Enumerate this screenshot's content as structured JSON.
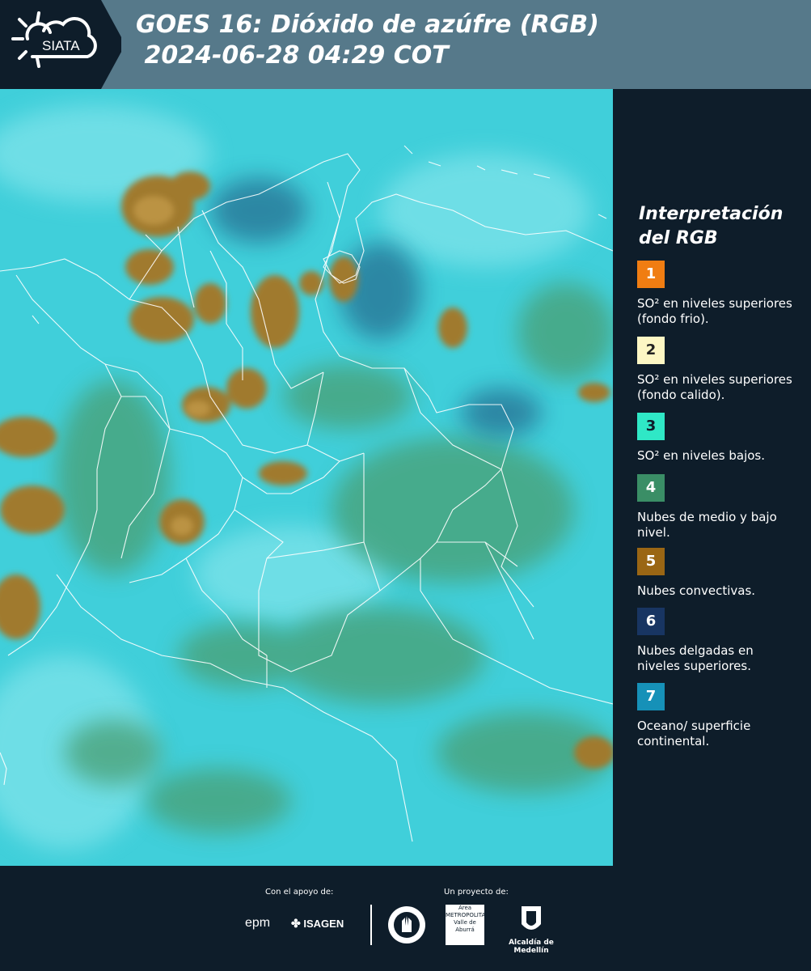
{
  "header": {
    "logo_text": "SIATA",
    "title_line1": "GOES 16: Dióxido de azúfre (RGB)",
    "title_line2": " 2024-06-28 04:29 COT",
    "background": "#56798a"
  },
  "legend": {
    "title": "Interpretación del RGB",
    "items": [
      {
        "number": "1",
        "color": "#f07d12",
        "text": "SO² en niveles superiores (fondo frio)."
      },
      {
        "number": "2",
        "color": "#fdf7c4",
        "text": "SO² en niveles superiores (fondo calido)."
      },
      {
        "number": "3",
        "color": "#2fe8c6",
        "text": "SO² en niveles bajos."
      },
      {
        "number": "4",
        "color": "#3a8e66",
        "text": "Nubes de medio y bajo nivel."
      },
      {
        "number": "5",
        "color": "#9a6614",
        "text": "Nubes convectivas."
      },
      {
        "number": "6",
        "color": "#183562",
        "text": "Nubes delgadas en niveles superiores."
      },
      {
        "number": "7",
        "color": "#1691b8",
        "text": "Oceano/ superficie continental."
      }
    ]
  },
  "footer": {
    "support_label": "Con el apoyo de:",
    "project_label": "Un proyecto de:",
    "sponsors": [
      "epm",
      "ISAGEN"
    ],
    "metro_text": "Área METROPOLITANA Valle de Aburrá",
    "alcaldia": "Alcaldía de Medellín"
  },
  "icons": {
    "logo": "sun-cloud-icon",
    "isagen": "isagen-icon",
    "seal": "seal-icon",
    "shield": "shield-icon"
  }
}
